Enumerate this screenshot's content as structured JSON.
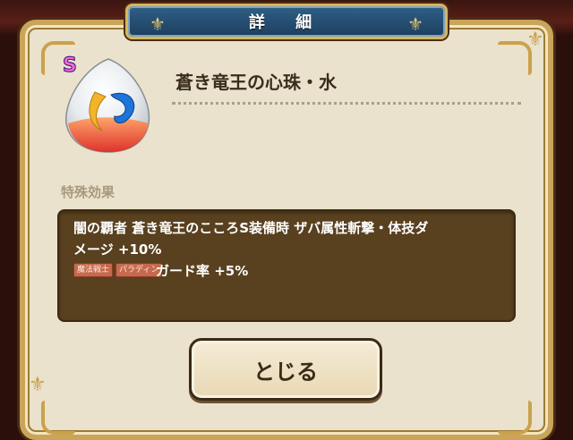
{
  "dialog": {
    "title": "詳 細",
    "close_label": "とじる"
  },
  "item": {
    "name": "蒼き竜王の心珠・水",
    "rank": "S",
    "icon": "water-orb-icon"
  },
  "effects": {
    "section_label": "特殊効果",
    "line1": "闇の覇者 蒼き竜王のこころS装備時 ザバ属性斬撃・体技ダ",
    "line2": "メージ +10%",
    "tags": [
      "魔法戦士",
      "パラディン"
    ],
    "line3": "ガード率 +5%"
  },
  "colors": {
    "panel_bg": "#eae2cd",
    "frame_gold": "#c9a45a",
    "title_blue": "#2f5f86",
    "effect_bg": "#59401f"
  }
}
